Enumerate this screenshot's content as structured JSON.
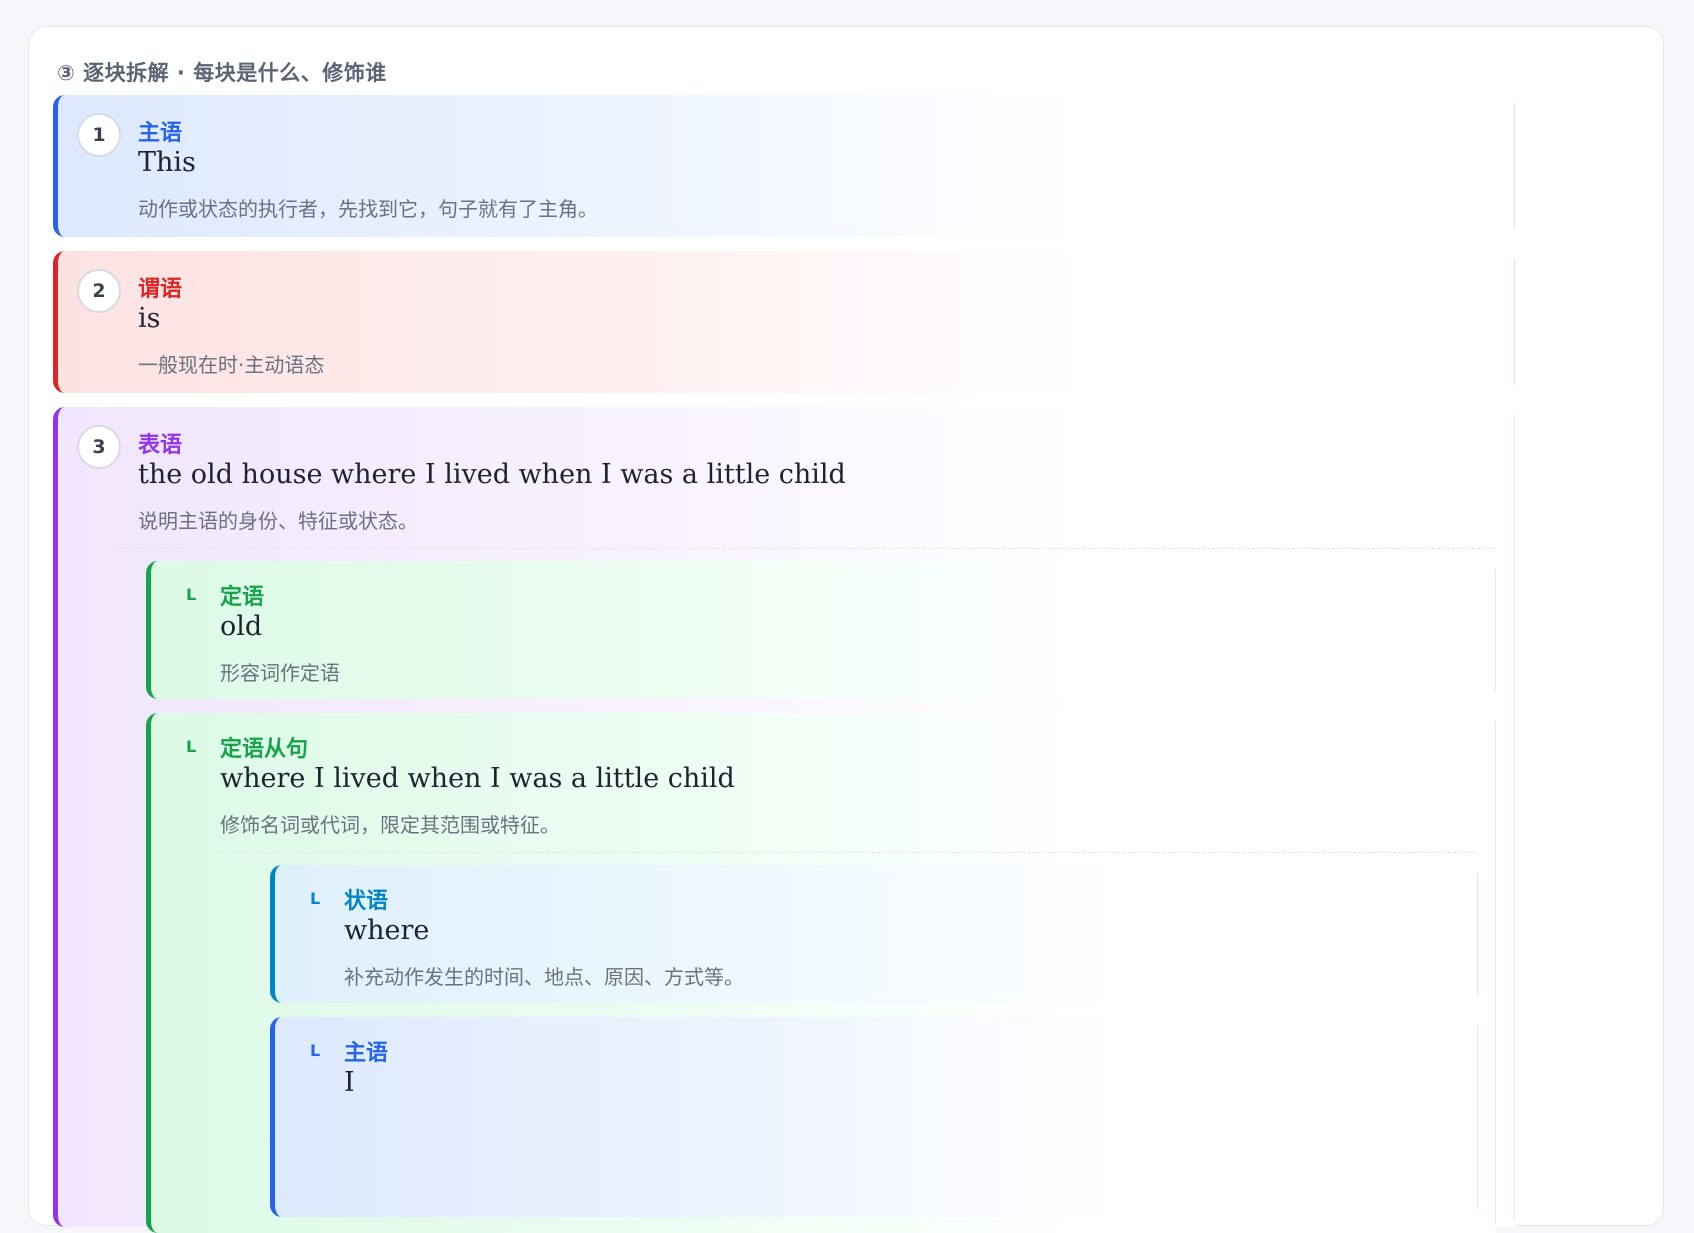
{
  "section": {
    "title": "③ 逐块拆解 · 每块是什么、修饰谁"
  },
  "blocks": [
    {
      "number": "1",
      "role": "主语",
      "phrase": "This",
      "desc": "动作或状态的执行者，先找到它，句子就有了主角。",
      "color": "#2563eb"
    },
    {
      "number": "2",
      "role": "谓语",
      "phrase": "is",
      "desc": "一般现在时·主动语态",
      "color": "#dc2626"
    },
    {
      "number": "3",
      "role": "表语",
      "phrase": "the old house where I lived when I was a little child",
      "desc": "说明主语的身份、特征或状态。",
      "color": "#9333ea",
      "children": [
        {
          "marker": "L",
          "role": "定语",
          "phrase": "old",
          "desc": "形容词作定语",
          "color": "#16a34a"
        },
        {
          "marker": "L",
          "role": "定语从句",
          "phrase": "where I lived when I was a little child",
          "desc": "修饰名词或代词，限定其范围或特征。",
          "color": "#16a34a",
          "children": [
            {
              "marker": "L",
              "role": "状语",
              "phrase": "where",
              "desc": "补充动作发生的时间、地点、原因、方式等。",
              "color": "#0284c7"
            },
            {
              "marker": "L",
              "role": "主语",
              "phrase": "I",
              "color": "#2563eb"
            }
          ]
        }
      ]
    }
  ]
}
